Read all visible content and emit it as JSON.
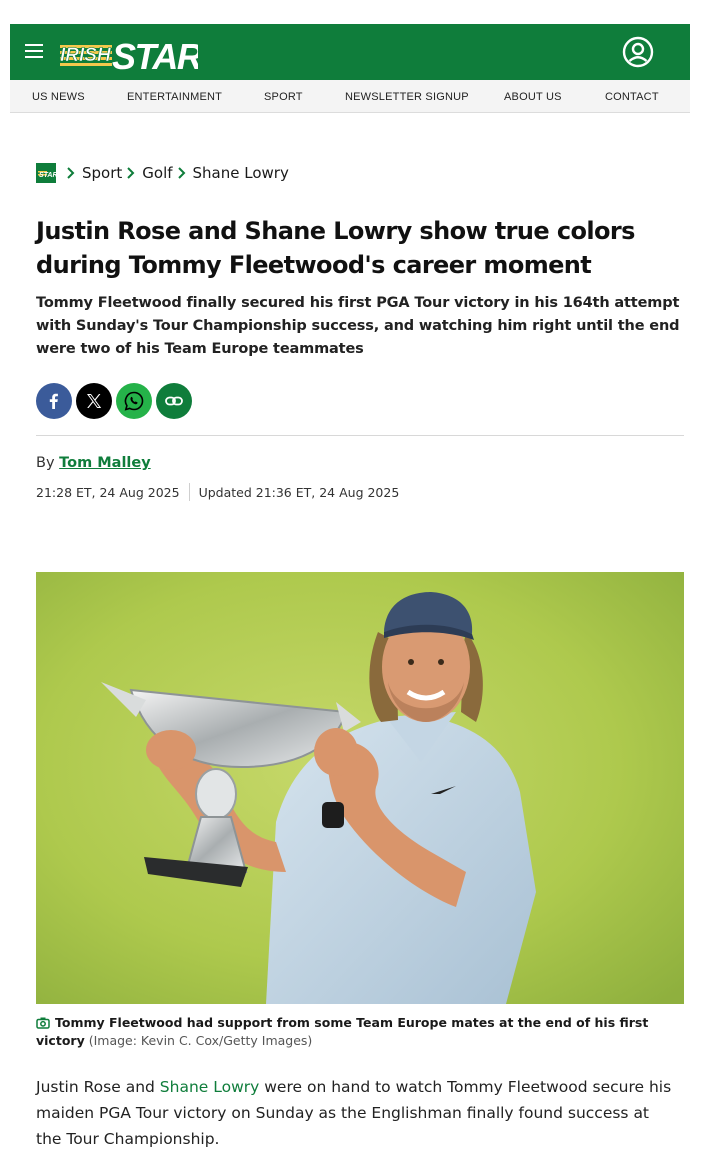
{
  "brand": {
    "name": "IRISH STAR",
    "accent_color": "#0f7d3b",
    "header_icons": [
      "hamburger-menu-icon",
      "user-account-icon"
    ]
  },
  "nav": {
    "items": [
      {
        "label": "US NEWS"
      },
      {
        "label": "ENTERTAINMENT"
      },
      {
        "label": "SPORT"
      },
      {
        "label": "NEWSLETTER SIGNUP"
      },
      {
        "label": "ABOUT US"
      },
      {
        "label": "CONTACT"
      }
    ]
  },
  "breadcrumb": {
    "items": [
      {
        "label": "Sport"
      },
      {
        "label": "Golf"
      },
      {
        "label": "Shane Lowry"
      }
    ]
  },
  "article": {
    "headline": "Justin Rose and Shane Lowry show true colors during Tommy Fleetwood's career moment",
    "standfirst": "Tommy Fleetwood finally secured his first PGA Tour victory in his 164th attempt with Sunday's Tour Championship success, and watching him right until the end were two of his Team Europe teammates",
    "share_icons": [
      "facebook-icon",
      "x-icon",
      "whatsapp-icon",
      "link-icon"
    ],
    "byline_prefix": "By ",
    "author": "Tom Malley",
    "published": "21:28 ET, 24 Aug 2025",
    "updated": "Updated 21:36 ET, 24 Aug 2025",
    "caption": "Tommy Fleetwood had support from some Team Europe mates at the end of his first victory",
    "caption_credit": "(Image: Kevin C. Cox/Getty Images)",
    "body": {
      "part1": "Justin Rose and ",
      "link": "Shane Lowry",
      "part2": " were on hand to watch Tommy Fleetwood secure his maiden PGA Tour victory on Sunday as the Englishman finally found success at the Tour Championship."
    }
  }
}
